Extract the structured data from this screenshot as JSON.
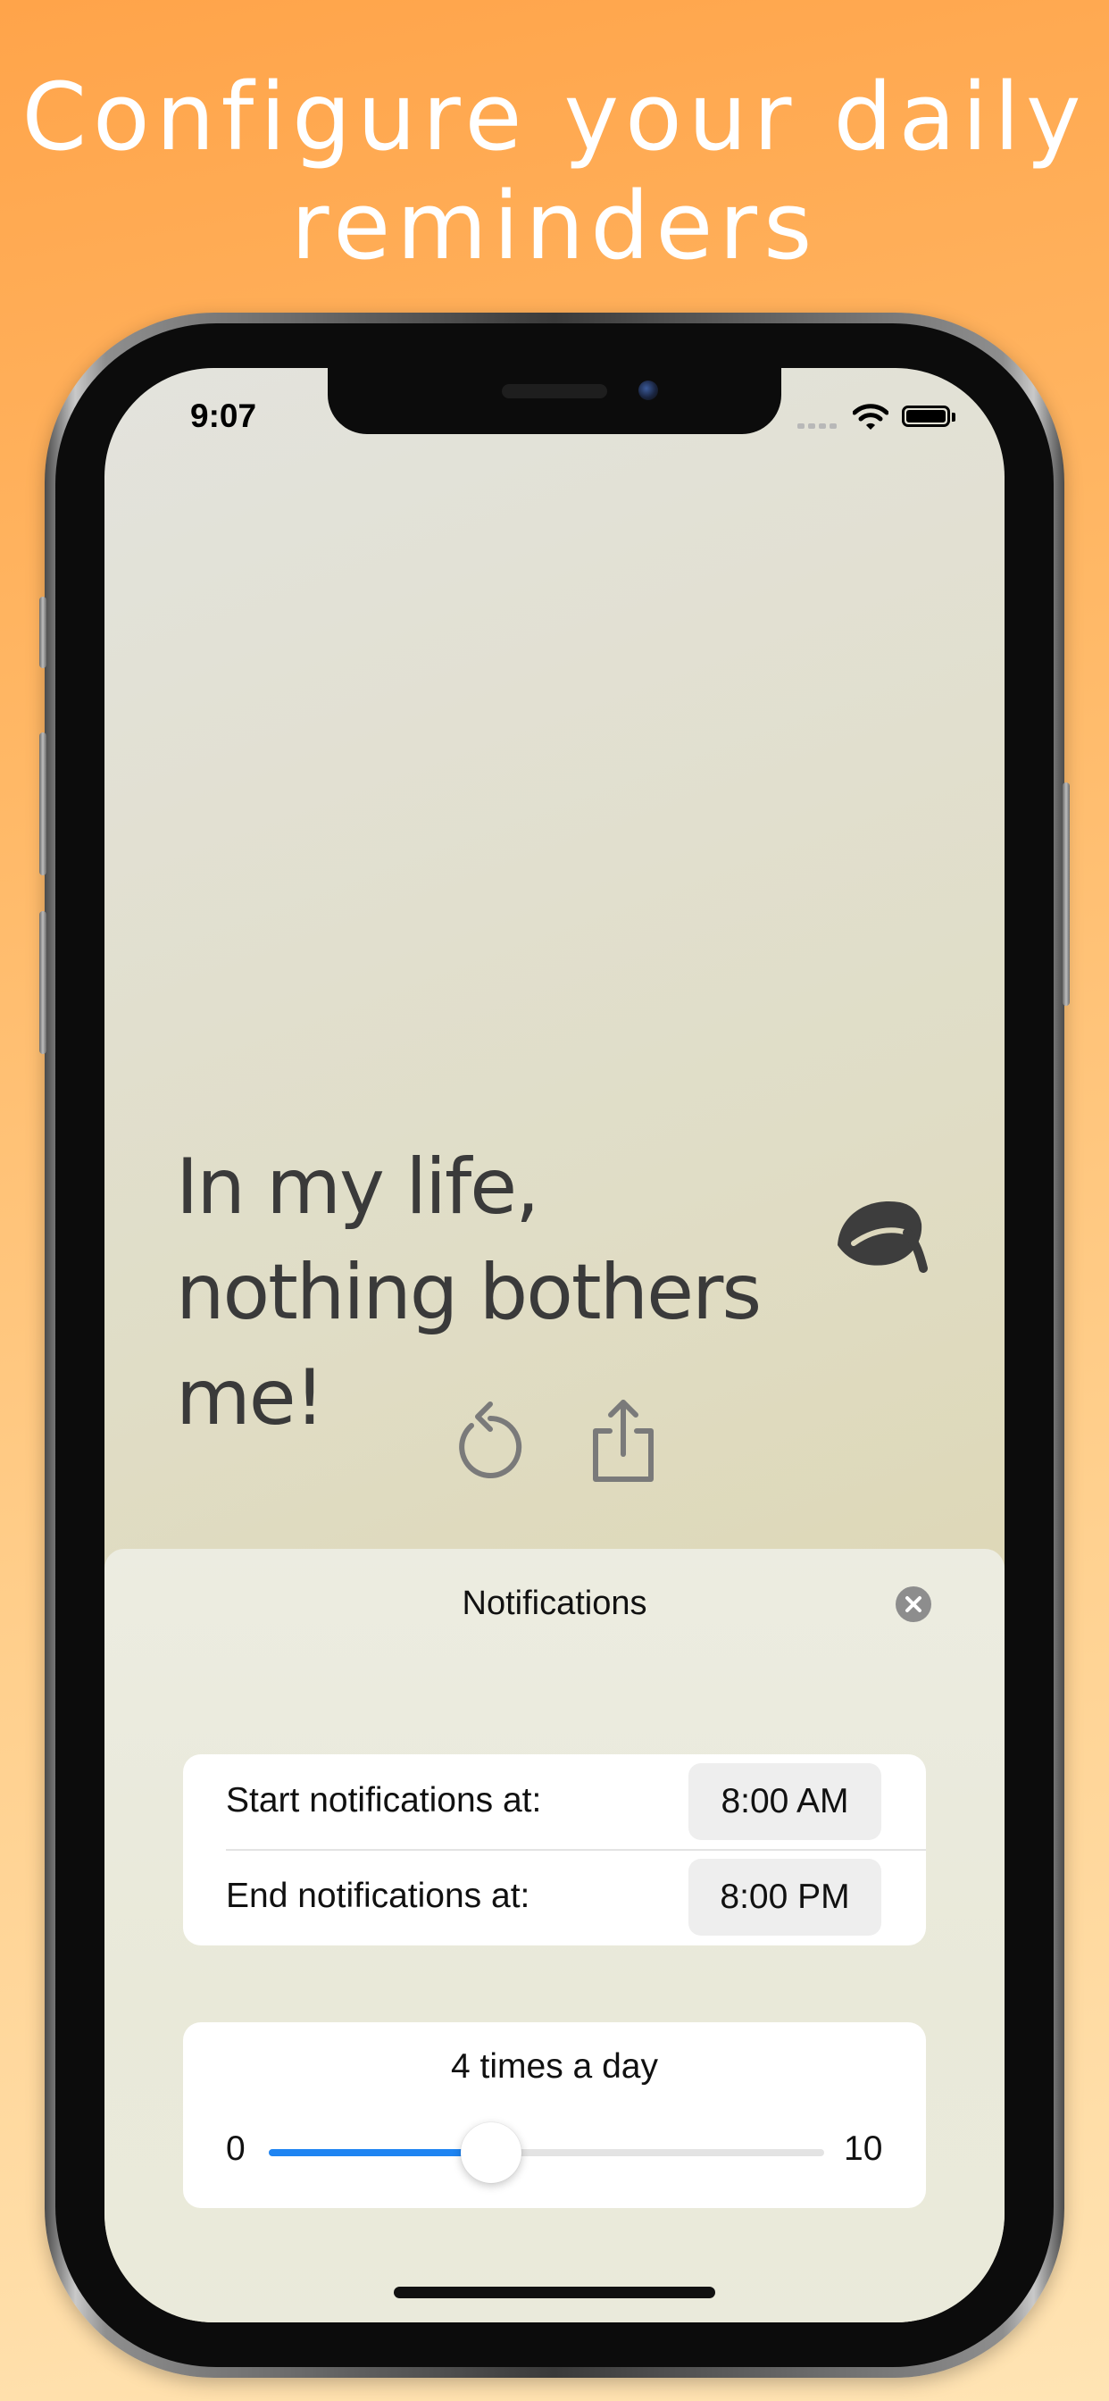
{
  "headline": {
    "line1": "Configure your daily",
    "line2": "reminders"
  },
  "status_bar": {
    "time": "9:07",
    "icons": [
      "signal-icon",
      "wifi-icon",
      "battery-icon"
    ]
  },
  "quote": {
    "text": "In my life, nothing bothers me!",
    "icon": "leaf-icon"
  },
  "actions": {
    "icons": [
      "refresh-icon",
      "share-icon"
    ]
  },
  "notifications": {
    "title": "Notifications",
    "close_icon": "close-icon",
    "start_label": "Start notifications at:",
    "start_time": "8:00 AM",
    "end_label": "End notifications at:",
    "end_time": "8:00 PM",
    "frequency_label": "4 times a day",
    "slider": {
      "min_label": "0",
      "max_label": "10",
      "min": 0,
      "max": 10,
      "value": 4
    }
  },
  "colors": {
    "accent": "#1e84f2",
    "background_top": "#ffa44a",
    "background_bottom": "#ffe4b4",
    "quote_text": "#3a3a3a"
  }
}
